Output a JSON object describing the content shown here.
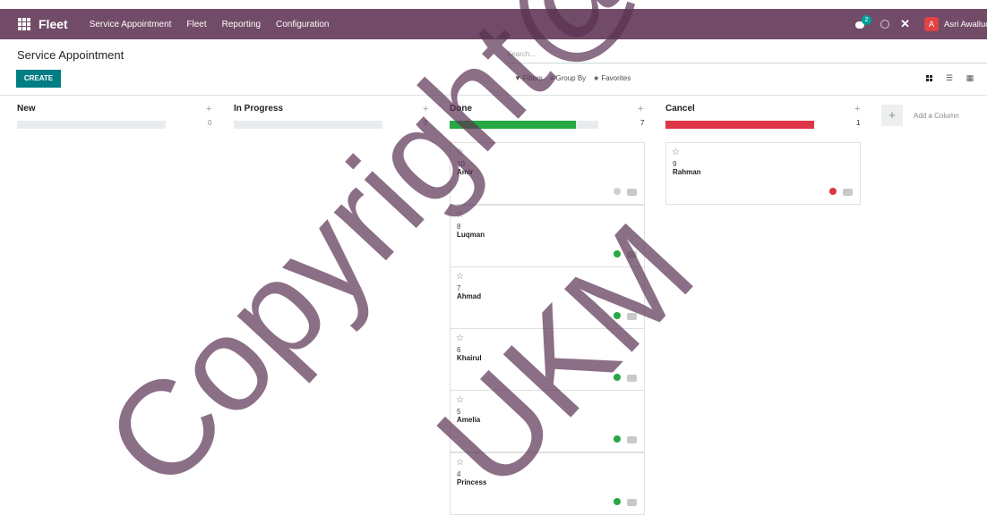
{
  "navbar": {
    "brand": "Fleet",
    "menu": [
      "Service Appointment",
      "Fleet",
      "Reporting",
      "Configuration"
    ],
    "chat_count": "2",
    "user_initial": "A",
    "user_name": "Asri Awalluddin",
    "bg_color": "#714b67",
    "icons": [
      "apps-grid-icon",
      "chat-icon",
      "clock-icon",
      "debug-icon"
    ]
  },
  "control_panel": {
    "title": "Service Appointment",
    "create_label": "CREATE",
    "search_placeholder": "Search...",
    "filters_label": "Filters",
    "group_by_label": "Group By",
    "favorites_label": "Favorites",
    "views": [
      "kanban",
      "list",
      "calendar",
      "more"
    ]
  },
  "kanban": {
    "columns": [
      {
        "title": "New",
        "count": "0",
        "progress_color": "#e9ecef",
        "progress": 0,
        "cards": []
      },
      {
        "title": "In Progress",
        "count": "0",
        "progress_color": "#e9ecef",
        "progress": 0,
        "cards": []
      },
      {
        "title": "Done",
        "count": "7",
        "progress_color": "#28a745",
        "progress": 0.85,
        "cards": [
          {
            "number": "10",
            "name": "Amir",
            "status": "grey"
          },
          {
            "number": "8",
            "name": "Luqman",
            "status": "green"
          },
          {
            "number": "7",
            "name": "Ahmad",
            "status": "green"
          },
          {
            "number": "6",
            "name": "Khairul",
            "status": "green"
          },
          {
            "number": "5",
            "name": "Amelia",
            "status": "green"
          },
          {
            "number": "4",
            "name": "Princess",
            "status": "green"
          }
        ]
      },
      {
        "title": "Cancel",
        "count": "1",
        "progress_color": "#dc3545",
        "progress": 1,
        "cards": [
          {
            "number": "9",
            "name": "Rahman",
            "status": "red"
          }
        ]
      }
    ],
    "add_column_label": "Add a Column",
    "status_colors": {
      "green": "#28a745",
      "red": "#dc3545",
      "grey": "#d0d0d0"
    }
  },
  "watermark": {
    "text_1": "Copyright@F",
    "text_2": "UKM",
    "color": "#5a3252"
  }
}
